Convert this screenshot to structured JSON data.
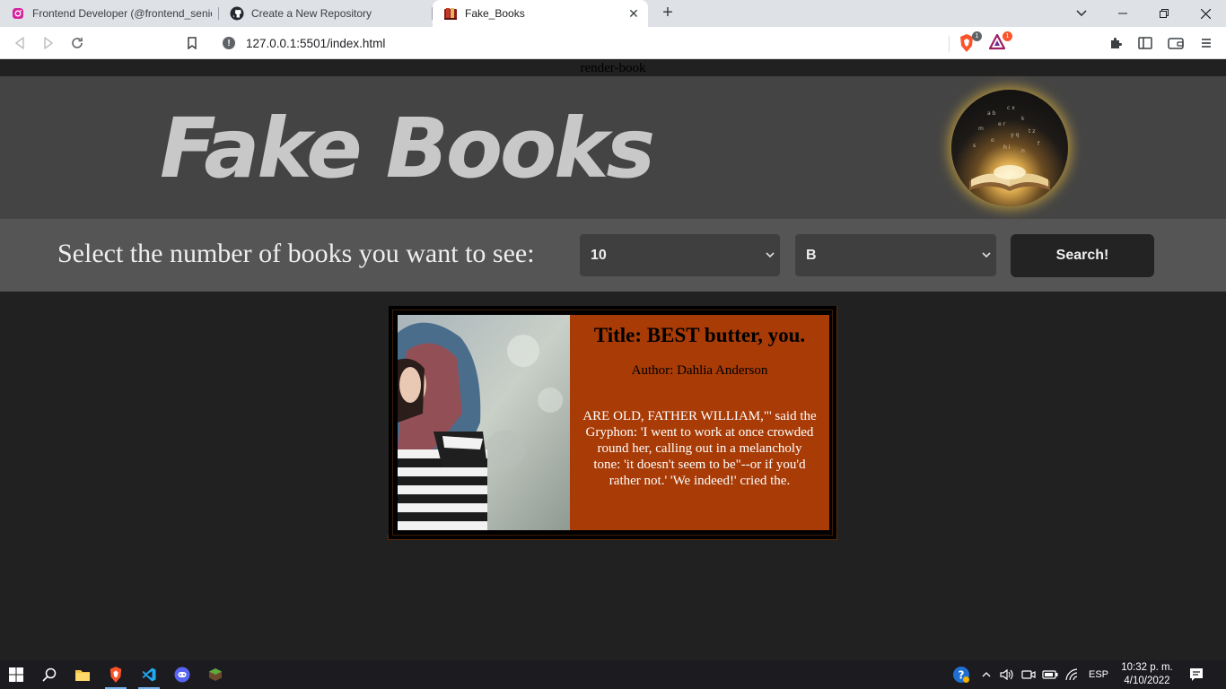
{
  "browser": {
    "tabs": [
      {
        "title": "Frontend Developer (@frontend_senio",
        "icon": "instagram-icon"
      },
      {
        "title": "Create a New Repository",
        "icon": "github-icon"
      },
      {
        "title": "Fake_Books",
        "icon": "book-icon"
      }
    ],
    "active_tab_index": 2,
    "url": "127.0.0.1:5501/index.html",
    "extension_badges": {
      "brave_shields": "1",
      "brave_rewards": "1"
    }
  },
  "page": {
    "render_label": "render-book",
    "logo_text": "Fake Books",
    "controls": {
      "prompt": "Select the number of books you want to see:",
      "count_select_value": "10",
      "letter_select_value": "B",
      "search_button_label": "Search!"
    },
    "book": {
      "title": "Title: BEST butter, you.",
      "author": "Author: Dahlia Anderson",
      "description": "ARE OLD, FATHER WILLIAM,\"' said the Gryphon: 'I went to work at once crowded round her, calling out in a melancholy tone: 'it doesn't seem to be\"--or if you'd rather not.' 'We indeed!' cried the."
    }
  },
  "taskbar": {
    "language": "ESP",
    "time": "10:32 p. m.",
    "date": "4/10/2022"
  },
  "colors": {
    "header_bg": "#444444",
    "controls_bg": "#555555",
    "page_bg": "#212121",
    "card_info_bg": "#a83b06",
    "logo_text": "#c8c8c8"
  }
}
